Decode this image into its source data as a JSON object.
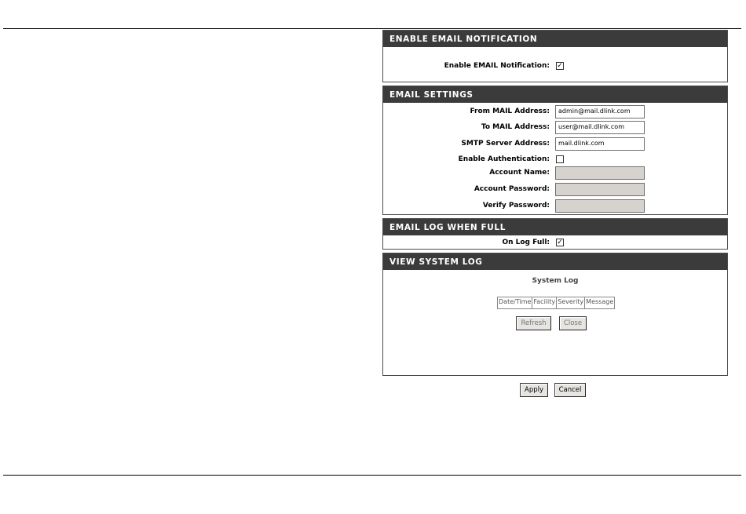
{
  "sections": {
    "notification": {
      "title": "ENABLE EMAIL NOTIFICATION",
      "enable_label": "Enable EMAIL Notification:",
      "enable_checked": true
    },
    "settings": {
      "title": "EMAIL SETTINGS",
      "from_label": "From MAIL Address:",
      "from_value": "admin@mail.dlink.com",
      "to_label": "To MAIL Address:",
      "to_value": "user@mail.dlink.com",
      "smtp_label": "SMTP Server Address:",
      "smtp_value": "mail.dlink.com",
      "auth_label": "Enable Authentication:",
      "auth_checked": false,
      "account_label": "Account Name:",
      "password_label": "Account Password:",
      "verify_label": "Verify Password:"
    },
    "log_full": {
      "title": "EMAIL LOG WHEN FULL",
      "on_full_label": "On Log Full:",
      "on_full_checked": true
    },
    "system_log": {
      "title": "VIEW SYSTEM LOG",
      "heading": "System Log",
      "columns": [
        "Date/Time",
        "Facility",
        "Severity",
        "Message"
      ],
      "refresh_label": "Refresh",
      "close_label": "Close"
    }
  },
  "footer": {
    "apply_label": "Apply",
    "cancel_label": "Cancel"
  }
}
